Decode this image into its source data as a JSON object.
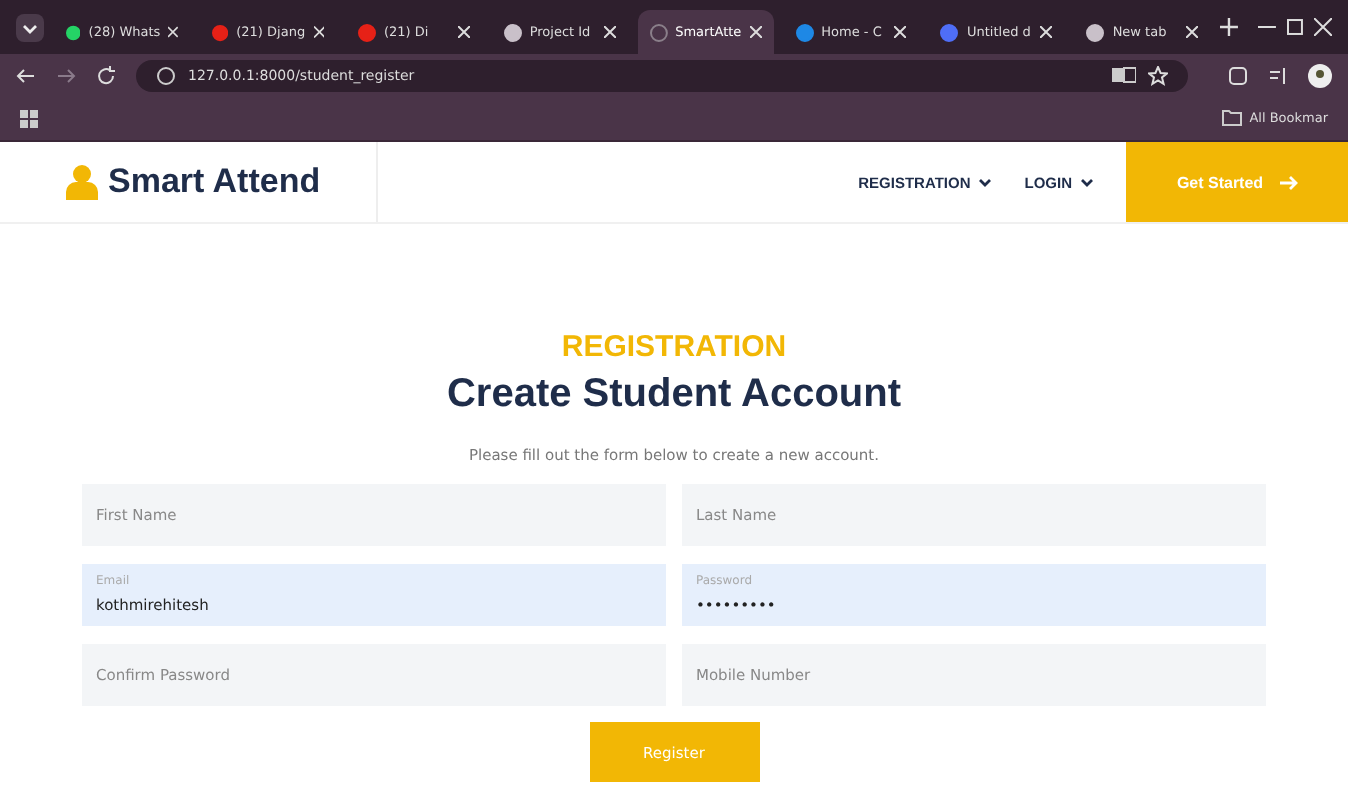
{
  "browser": {
    "tabs": [
      {
        "label": "(28) Whats",
        "selected": false,
        "kind": "green"
      },
      {
        "label": "(21) Djang",
        "selected": false,
        "kind": "red"
      },
      {
        "label": "(21) Di",
        "selected": false,
        "kind": "red"
      },
      {
        "label": "Project Id",
        "selected": false,
        "kind": "globe"
      },
      {
        "label": "SmartAtte",
        "selected": true,
        "kind": "loading"
      },
      {
        "label": "Home - C",
        "selected": false,
        "kind": "blue"
      },
      {
        "label": "Untitled d",
        "selected": false,
        "kind": "doc"
      },
      {
        "label": "New tab",
        "selected": false,
        "kind": "globe"
      }
    ],
    "url": "127.0.0.1:8000/student_register",
    "bookmarks": "All Bookmar"
  },
  "header": {
    "brand": "Smart Attend",
    "nav": [
      "REGISTRATION",
      "LOGIN"
    ],
    "cta": "Get Started"
  },
  "eyebrow": "REGISTRATION",
  "heading": "Create Student Account",
  "subtitle": "Please fill out the form below to create a new account.",
  "fields": [
    {
      "placeholder": "First Name",
      "autofilled": false
    },
    {
      "placeholder": "Last Name",
      "autofilled": false
    },
    {
      "label": "Email",
      "value": "kothmirehitesh",
      "autofilled": true
    },
    {
      "label": "Password",
      "value": "•••••••••",
      "autofilled": true
    },
    {
      "placeholder": "Confirm Password",
      "autofilled": false
    },
    {
      "placeholder": "Mobile Number",
      "autofilled": false
    }
  ],
  "submit": "Register"
}
